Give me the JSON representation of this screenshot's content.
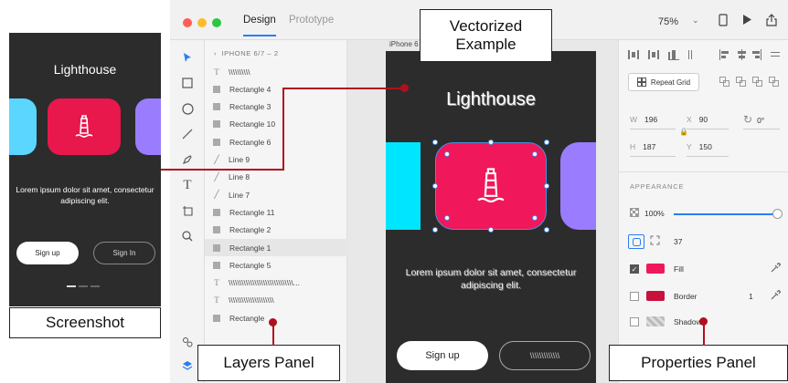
{
  "captions": {
    "screenshot": "Screenshot",
    "vectorized_line1": "Vectorized",
    "vectorized_line2": "Example",
    "layers_panel": "Layers Panel",
    "properties_panel": "Properties Panel"
  },
  "phone": {
    "title": "Lighthouse",
    "body": "Lorem ipsum dolor sit amet, consectetur adipiscing elit.",
    "signup": "Sign up",
    "signin": "Sign In"
  },
  "window": {
    "tabs": {
      "design": "Design",
      "prototype": "Prototype"
    },
    "zoom": "75%",
    "zoom_arrow": "⌄"
  },
  "layers": {
    "header": "IPHONE 6/7 – 2",
    "items": [
      {
        "icon": "T",
        "label": "\\\\\\\\\\\\\\\\\\\\"
      },
      {
        "icon": "rect",
        "label": "Rectangle 4"
      },
      {
        "icon": "rect",
        "label": "Rectangle 3"
      },
      {
        "icon": "rect",
        "label": "Rectangle 10"
      },
      {
        "icon": "rect",
        "label": "Rectangle 6"
      },
      {
        "icon": "line",
        "label": "Line 9"
      },
      {
        "icon": "line",
        "label": "Line 8"
      },
      {
        "icon": "line",
        "label": "Line 7"
      },
      {
        "icon": "rect",
        "label": "Rectangle 11"
      },
      {
        "icon": "rect",
        "label": "Rectangle 2"
      },
      {
        "icon": "rect",
        "label": "Rectangle 1",
        "selected": true
      },
      {
        "icon": "rect",
        "label": "Rectangle 5"
      },
      {
        "icon": "T",
        "label": "\\\\\\\\\\\\\\\\\\\\\\\\\\\\\\\\\\\\\\\\\\\\\\\\\\\\\\\\\\\\..."
      },
      {
        "icon": "T",
        "label": "\\\\\\\\\\\\\\\\\\\\\\\\\\\\\\\\\\\\\\\\\\"
      },
      {
        "icon": "rect",
        "label": "Rectangle"
      }
    ]
  },
  "artboard": {
    "label": "iPhone 6",
    "title": "Lighthouse",
    "body": "Lorem ipsum dolor sit amet, consectetur adipiscing elit.",
    "signup": "Sign up",
    "signin": "\\\\\\\\\\\\\\\\\\\\\\\\\\"
  },
  "properties": {
    "repeat_grid": "Repeat Grid",
    "w_key": "W",
    "w_val": "196",
    "x_key": "X",
    "x_val": "90",
    "rot_val": "0°",
    "h_key": "H",
    "h_val": "187",
    "y_key": "Y",
    "y_val": "150",
    "appearance": "APPEARANCE",
    "opacity": "100%",
    "radius": "37",
    "fill_label": "Fill",
    "fill_color": "#f0175a",
    "border_label": "Border",
    "border_color": "#c8103c",
    "border_width": "1",
    "shadow_label": "Shadow"
  },
  "colors": {
    "accent": "#2b7cf5",
    "callout_red": "#b0101e",
    "card_pink": "#e8174c",
    "card_cyan": "#00e5ff",
    "card_purple": "#9a7cff"
  }
}
